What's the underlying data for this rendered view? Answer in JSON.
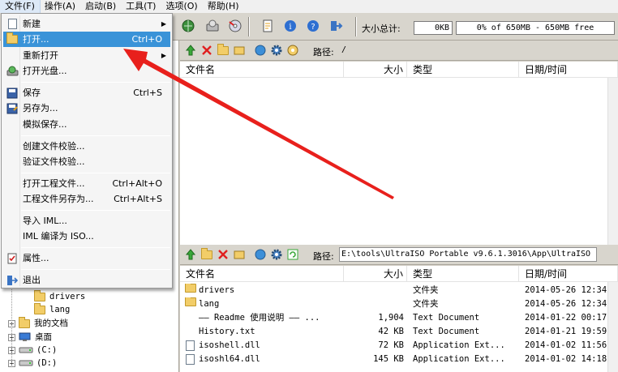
{
  "menubar": {
    "items": [
      "文件(F)",
      "操作(A)",
      "启动(B)",
      "工具(T)",
      "选项(O)",
      "帮助(H)"
    ]
  },
  "toolbar": {
    "size_label": "大小总计:",
    "size_value": "0KB",
    "capacity_text": "0% of 650MB - 650MB free"
  },
  "file_menu": {
    "items": [
      {
        "label": "新建",
        "shortcut": "",
        "submenu": true
      },
      {
        "label": "打开...",
        "shortcut": "Ctrl+O"
      },
      {
        "label": "重新打开",
        "shortcut": "",
        "submenu": true
      },
      {
        "label": "打开光盘...",
        "shortcut": ""
      },
      {
        "label": "保存",
        "shortcut": "Ctrl+S"
      },
      {
        "label": "另存为...",
        "shortcut": ""
      },
      {
        "label": "模拟保存...",
        "shortcut": ""
      },
      {
        "label": "创建文件校验...",
        "shortcut": ""
      },
      {
        "label": "验证文件校验...",
        "shortcut": ""
      },
      {
        "label": "打开工程文件...",
        "shortcut": "Ctrl+Alt+O"
      },
      {
        "label": "工程文件另存为...",
        "shortcut": "Ctrl+Alt+S"
      },
      {
        "label": "导入 IML...",
        "shortcut": ""
      },
      {
        "label": "IML 编译为 ISO...",
        "shortcut": ""
      },
      {
        "label": "属性...",
        "shortcut": ""
      },
      {
        "label": "退出",
        "shortcut": ""
      }
    ]
  },
  "iso_pane": {
    "path_label": "路径:",
    "path_value": "/",
    "columns": [
      "文件名",
      "大小",
      "类型",
      "日期/时间"
    ]
  },
  "local_pane": {
    "path_label": "路径:",
    "path_value": "E:\\tools\\UltraISO Portable v9.6.1.3016\\App\\UltraISO",
    "columns": [
      "文件名",
      "大小",
      "类型",
      "日期/时间"
    ],
    "rows": [
      {
        "name": "drivers",
        "size": "",
        "type": "文件夹",
        "date": "2014-05-26 12:34",
        "icon": "folder-icon"
      },
      {
        "name": "lang",
        "size": "",
        "type": "文件夹",
        "date": "2014-05-26 12:34",
        "icon": "folder-icon"
      },
      {
        "name": "—— Readme 使用说明 —— ...",
        "size": "1,904",
        "type": "Text Document",
        "date": "2014-01-22 00:17",
        "icon": "none"
      },
      {
        "name": "History.txt",
        "size": "42 KB",
        "type": "Text Document",
        "date": "2014-01-21 19:59",
        "icon": "none"
      },
      {
        "name": "isoshell.dll",
        "size": "72 KB",
        "type": "Application Ext...",
        "date": "2014-01-02 11:56",
        "icon": "dll-icon"
      },
      {
        "name": "isoshl64.dll",
        "size": "145 KB",
        "type": "Application Ext...",
        "date": "2014-01-02 14:18",
        "icon": "dll-icon"
      }
    ]
  },
  "tree": {
    "items": [
      {
        "label": "drivers"
      },
      {
        "label": "lang"
      },
      {
        "label": "我的文档"
      },
      {
        "label": "桌面"
      },
      {
        "label": "(C:)"
      },
      {
        "label": "(D:)"
      }
    ]
  },
  "colors": {
    "highlight": "#3a93d8",
    "arrow": "#e8201c"
  }
}
